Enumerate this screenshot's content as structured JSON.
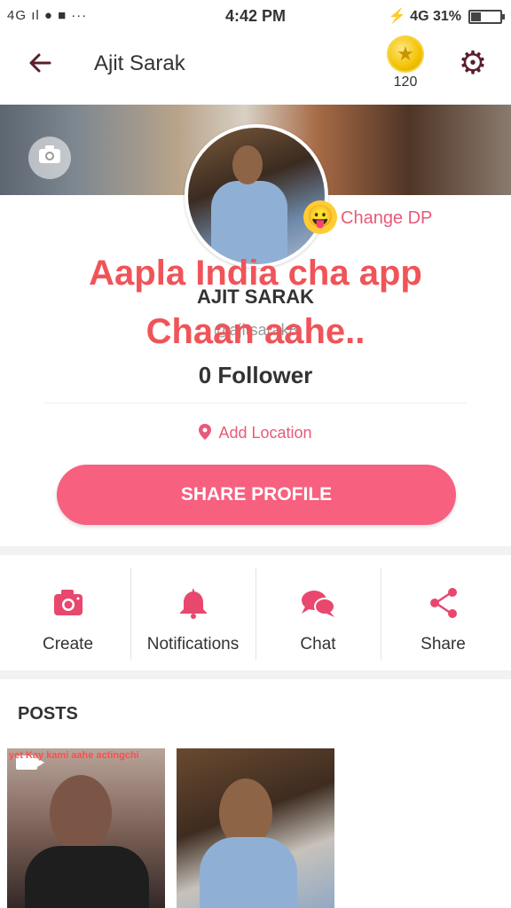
{
  "status_bar": {
    "left": "4G",
    "time": "4:42 PM",
    "network": "4G",
    "battery": "31%",
    "battery_level": 0.31
  },
  "app_bar": {
    "title": "Ajit Sarak",
    "coins": "120"
  },
  "profile": {
    "change_dp": "Change DP",
    "overlay_line1": "Aapla India cha app",
    "overlay_line2": "Chaan aahe..",
    "name": "AJIT SARAK",
    "handle": "@ajitsarak8",
    "followers": "0 Follower",
    "location": "Add Location",
    "share_button": "SHARE PROFILE"
  },
  "actions": [
    {
      "label": "Create",
      "icon": "camera-icon"
    },
    {
      "label": "Notifications",
      "icon": "bell-icon"
    },
    {
      "label": "Chat",
      "icon": "chat-icon"
    },
    {
      "label": "Share",
      "icon": "share-icon"
    }
  ],
  "posts": {
    "title": "POSTS",
    "items": [
      {
        "caption": "yet Kay kami aahe actingchi"
      },
      {
        "caption": ""
      }
    ]
  },
  "colors": {
    "accent": "#f7607f",
    "pink_text": "#e85a7a",
    "dark_icon": "#5a1f2c",
    "overlay": "#f05458"
  }
}
